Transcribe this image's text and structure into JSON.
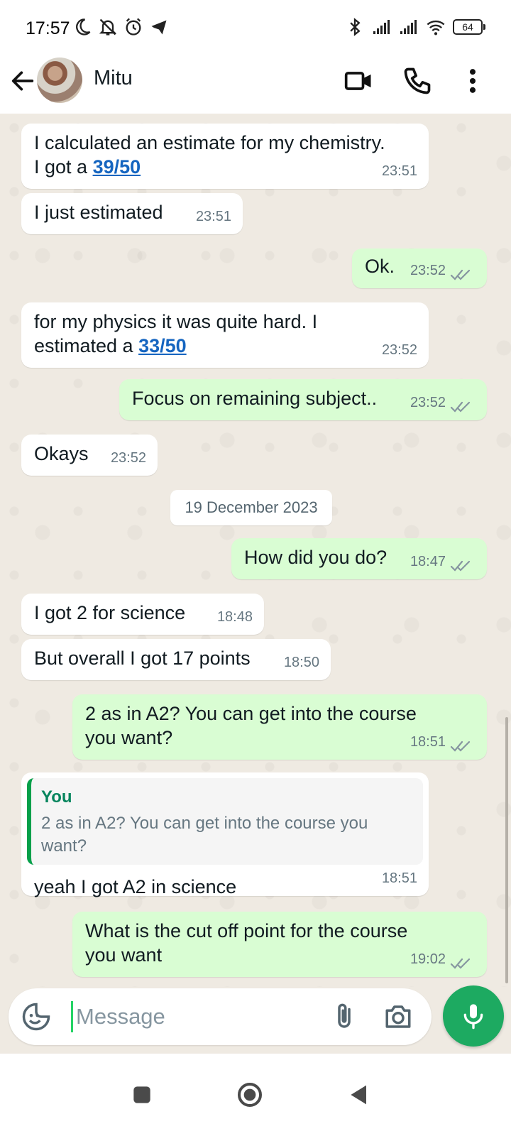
{
  "status_bar": {
    "time": "17:57",
    "battery": "64"
  },
  "header": {
    "contact_name": "Mitu"
  },
  "messages": [
    {
      "text_pre": "I calculated an estimate for my chemistry.\nI got a ",
      "link": "39/50",
      "time": "23:51",
      "dir": "in"
    },
    {
      "text": "I just estimated",
      "time": "23:51",
      "dir": "in"
    },
    {
      "text": "Ok.",
      "time": "23:52",
      "dir": "out"
    },
    {
      "text_pre": "for my physics it was quite hard. I\nestimated a ",
      "link": "33/50",
      "time": "23:52",
      "dir": "in"
    },
    {
      "text": "Focus on remaining subject..",
      "time": "23:52",
      "dir": "out"
    },
    {
      "text": "Okays",
      "time": "23:52",
      "dir": "in"
    },
    {
      "text": "How did you do?",
      "time": "18:47",
      "dir": "out"
    },
    {
      "text": "I got 2 for science",
      "time": "18:48",
      "dir": "in"
    },
    {
      "text": "But overall I got 17 points",
      "time": "18:50",
      "dir": "in"
    },
    {
      "text": "2 as in A2? You can get into the course\nyou want?",
      "time": "18:51",
      "dir": "out"
    },
    {
      "quote_author": "You",
      "quote_text": "2 as in A2? You can get into the course you want?",
      "text": "yeah I got A2 in science",
      "time": "18:51",
      "dir": "in"
    },
    {
      "text": "What is the cut off point for the course\nyou want",
      "time": "19:02",
      "dir": "out"
    }
  ],
  "date_separator": "19 December 2023",
  "composer": {
    "placeholder": "Message"
  },
  "colors": {
    "outgoing_bubble": "#d9fdd3",
    "incoming_bubble": "#ffffff",
    "chat_background": "#efeae2",
    "accent_green": "#1daa61",
    "link_blue": "#1565c0",
    "read_ticks": "#8696a0"
  },
  "icons": [
    "back-arrow-icon",
    "video-call-icon",
    "voice-call-icon",
    "more-options-icon",
    "sticker-icon",
    "attach-icon",
    "camera-icon",
    "mic-icon",
    "double-check-icon"
  ]
}
